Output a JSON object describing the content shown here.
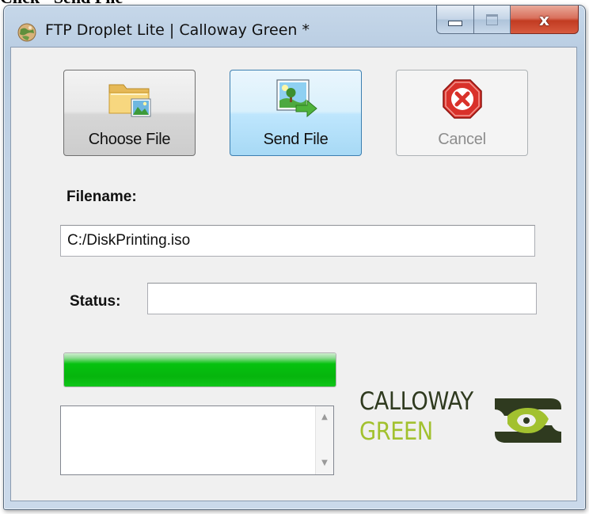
{
  "caption": "Click \"Send File\"",
  "window": {
    "title": "FTP Droplet Lite | Calloway Green *",
    "controls": {
      "minimize": "minimize",
      "maximize": "maximize",
      "close": "x"
    }
  },
  "toolbar": {
    "choose_label": "Choose File",
    "send_label": "Send File",
    "cancel_label": "Cancel",
    "cancel_enabled": false
  },
  "form": {
    "filename_label": "Filename:",
    "filename_value": "C:/DiskPrinting.iso",
    "status_label": "Status:",
    "status_value": ""
  },
  "progress": {
    "fraction": 1.0,
    "color": "#06c20f"
  },
  "log": {
    "text": ""
  },
  "logo": {
    "line1": "CALLOWAY",
    "line2": "GREEN",
    "dark_color": "#2f3a1f",
    "accent_color": "#a2c12f"
  },
  "icons": {
    "app": "app-globe-icon",
    "choose": "folder-image-icon",
    "send": "image-send-icon",
    "cancel": "stop-x-icon"
  }
}
